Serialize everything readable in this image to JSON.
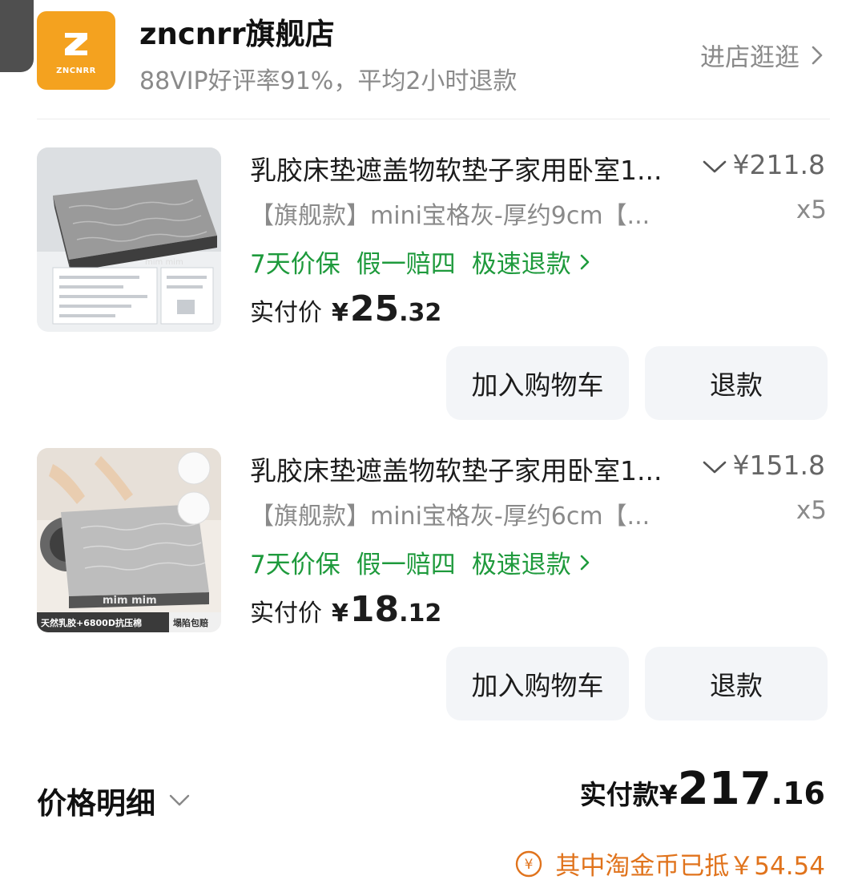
{
  "store": {
    "logo_text": "ZNCNRR",
    "name": "zncnrr旗舰店",
    "subtitle": "88VIP好评率91%，平均2小时退款",
    "visit_label": "进店逛逛"
  },
  "items": [
    {
      "title": "乳胶床垫遮盖物软垫子家用卧室1...",
      "price": "¥211.8",
      "variant": "【旗舰款】mini宝格灰-厚约9cm【...",
      "qty": "x5",
      "tags": [
        "7天价保",
        "假一赔四",
        "极速退款"
      ],
      "paid_label": "实付价",
      "paid_currency": "¥",
      "paid_int": "25",
      "paid_dec": ".32",
      "thumb_texts": [
        "mim mim"
      ],
      "cart_label": "加入购物车",
      "refund_label": "退款"
    },
    {
      "title": "乳胶床垫遮盖物软垫子家用卧室1...",
      "price": "¥151.8",
      "variant": "【旗舰款】mini宝格灰-厚约6cm【...",
      "qty": "x5",
      "tags": [
        "7天价保",
        "假一赔四",
        "极速退款"
      ],
      "paid_label": "实付价",
      "paid_currency": "¥",
      "paid_int": "18",
      "paid_dec": ".12",
      "thumb_texts": [
        "mim mim",
        "天然乳胶+6800D抗压棉",
        "塌陷包赔"
      ],
      "cart_label": "加入购物车",
      "refund_label": "退款"
    }
  ],
  "summary": {
    "price_detail_label": "价格明细",
    "total_label": "实付款",
    "total_currency": "¥",
    "total_int": "217",
    "total_dec": ".16",
    "coin_icon_glyph": "¥",
    "coin_text": "其中淘金币已抵￥54.54"
  },
  "colors": {
    "brand_orange": "#f4a21f",
    "service_green": "#1e9a3c",
    "coin_orange": "#e0731c",
    "button_bg": "#f3f5f8"
  },
  "icons": [
    "zncnrr-logo-icon",
    "chevron-right-icon",
    "chevron-down-icon",
    "coin-icon"
  ]
}
